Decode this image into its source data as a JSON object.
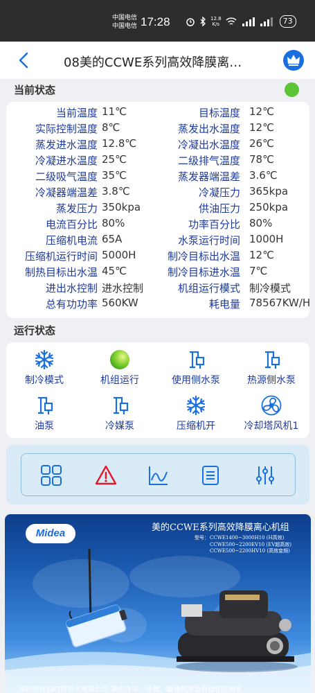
{
  "statusbar": {
    "carrier1": "中国电信",
    "carrier2": "中国电信",
    "time": "17:28",
    "net_speed_value": "12.8",
    "net_speed_unit": "K/s",
    "battery": "73"
  },
  "header": {
    "title": "08美的CCWE系列高效降膜离…"
  },
  "current_state": {
    "label": "当前状态",
    "status_color": "#5cc437",
    "rows": [
      {
        "k1": "当前温度",
        "v1": "11℃",
        "k2": "目标温度",
        "v2": "12℃"
      },
      {
        "k1": "实际控制温度",
        "v1": "8℃",
        "k2": "蒸发出水温度",
        "v2": "12℃"
      },
      {
        "k1": "蒸发进水温度",
        "v1": "12.8℃",
        "k2": "冷凝出水温度",
        "v2": "26℃"
      },
      {
        "k1": "冷凝进水温度",
        "v1": "25℃",
        "k2": "二级排气温度",
        "v2": "78℃"
      },
      {
        "k1": "二级吸气温度",
        "v1": "35℃",
        "k2": "蒸发器端温差",
        "v2": "3.6℃"
      },
      {
        "k1": "冷凝器端温差",
        "v1": "3.8℃",
        "k2": "冷凝压力",
        "v2": "365kpa"
      },
      {
        "k1": "蒸发压力",
        "v1": "350kpa",
        "k2": "供油压力",
        "v2": "250kpa"
      },
      {
        "k1": "电流百分比",
        "v1": "80%",
        "k2": "功率百分比",
        "v2": "80%"
      },
      {
        "k1": "压缩机电流",
        "v1": "65A",
        "k2": "水泵运行时间",
        "v2": "1000H"
      },
      {
        "k1": "压缩机运行时间",
        "v1": "5000H",
        "k2": "制冷目标出水温",
        "v2": "12℃"
      },
      {
        "k1": "制热目标出水温",
        "v1": "45℃",
        "k2": "制冷目标进水温",
        "v2": "7℃"
      },
      {
        "k1": "进出水控制",
        "v1": "进水控制",
        "k2": "机组运行模式",
        "v2": "制冷模式"
      },
      {
        "k1": "总有功功率",
        "v1": "560KW",
        "k2": "耗电量",
        "v2": "78567KW/H"
      }
    ]
  },
  "run_state": {
    "label": "运行状态",
    "items": [
      {
        "label": "制冷模式",
        "icon": "snowflake-icon"
      },
      {
        "label": "机组运行",
        "icon": "green-ball-icon"
      },
      {
        "label": "使用侧水泵",
        "icon": "water-pump-icon"
      },
      {
        "label": "热源侧水泵",
        "icon": "water-pump-icon"
      },
      {
        "label": "油泵",
        "icon": "oil-pump-icon"
      },
      {
        "label": "冷媒泵",
        "icon": "refrigerant-pump-icon"
      },
      {
        "label": "压缩机开",
        "icon": "snowflake-icon"
      },
      {
        "label": "冷却塔风机1",
        "icon": "fan-icon"
      }
    ]
  },
  "toolbar": {
    "icons": [
      "grid-icon",
      "warning-icon",
      "chart-icon",
      "list-icon",
      "settings-sliders-icon"
    ]
  },
  "banner": {
    "logo": "Midea",
    "title": "美的CCWE系列高效降膜离心机组",
    "models_label": "型号：",
    "models": [
      "CCWE1400~3000H10 (H高效)",
      "CCWE500~2200EV10 (EV超高效)",
      "CCWE500~2200HV10 (高效变频)"
    ],
    "footer": "深圳市佳韵时控技术有限公司   提供冷冻、冷藏、暖通数控及自动化控制系"
  }
}
